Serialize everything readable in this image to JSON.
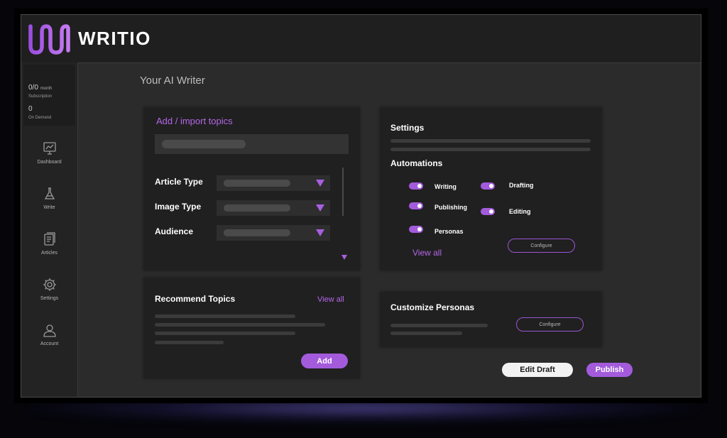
{
  "app": {
    "name": "WRITIO",
    "page_title": "Your AI Writer"
  },
  "colors": {
    "accent": "#a35bdc",
    "background": "#2b2b2b",
    "card": "#202020"
  },
  "sidebar": {
    "subscription": {
      "value": "0/0",
      "unit": "month",
      "label": "Subscription"
    },
    "on_demand": {
      "value": "0",
      "label": "On Demand"
    },
    "items": [
      {
        "label": "Dashboard",
        "icon": "dashboard-icon"
      },
      {
        "label": "Write",
        "icon": "write-icon"
      },
      {
        "label": "Articles",
        "icon": "articles-icon"
      },
      {
        "label": "Settings",
        "icon": "gear-icon"
      },
      {
        "label": "Account",
        "icon": "account-icon"
      }
    ]
  },
  "topics_card": {
    "title": "Add / import topics",
    "fields": [
      {
        "label": "Article Type"
      },
      {
        "label": "Image Type"
      },
      {
        "label": "Audience"
      }
    ]
  },
  "recommend_card": {
    "title": "Recommend Topics",
    "view_all": "View all",
    "add_button": "Add"
  },
  "settings_card": {
    "title": "Settings",
    "automations_title": "Automations",
    "toggles": [
      {
        "label": "Writing",
        "on": true
      },
      {
        "label": "Publishing",
        "on": true
      },
      {
        "label": "Personas",
        "on": true
      },
      {
        "label": "Drafting",
        "on": true
      },
      {
        "label": "Editing",
        "on": true
      }
    ],
    "view_all": "View all",
    "configure": "Configure"
  },
  "personas_card": {
    "title": "Customize Personas",
    "configure": "Configure"
  },
  "actions": {
    "edit_draft": "Edit Draft",
    "publish": "Publish"
  }
}
